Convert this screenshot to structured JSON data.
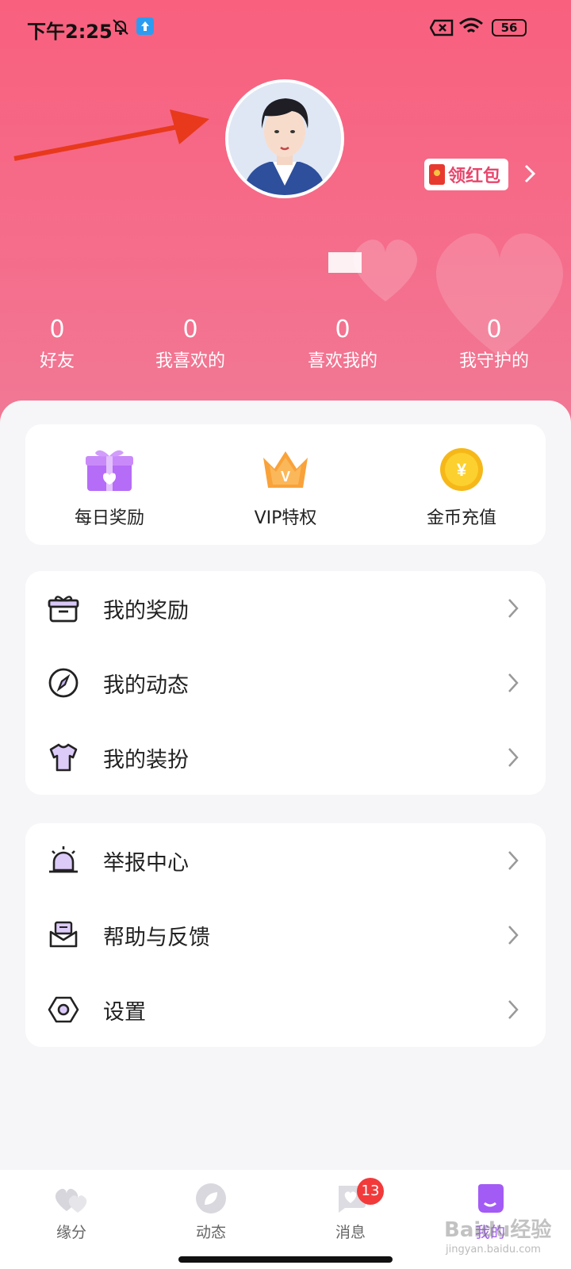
{
  "status_bar": {
    "time": "下午2:25",
    "battery": "56"
  },
  "header": {
    "red_packet_label": "领红包",
    "stats": [
      {
        "value": "0",
        "label": "好友"
      },
      {
        "value": "0",
        "label": "我喜欢的"
      },
      {
        "value": "0",
        "label": "喜欢我的"
      },
      {
        "value": "0",
        "label": "我守护的"
      }
    ]
  },
  "quick_actions": [
    {
      "label": "每日奖励",
      "icon": "gift-box-icon"
    },
    {
      "label": "VIP特权",
      "icon": "vip-crown-icon"
    },
    {
      "label": "金币充值",
      "icon": "gold-coin-icon"
    }
  ],
  "menu_group_1": [
    {
      "label": "我的奖励",
      "icon": "gift-icon"
    },
    {
      "label": "我的动态",
      "icon": "compass-icon"
    },
    {
      "label": "我的装扮",
      "icon": "tshirt-icon"
    }
  ],
  "menu_group_2": [
    {
      "label": "举报中心",
      "icon": "alarm-icon"
    },
    {
      "label": "帮助与反馈",
      "icon": "mail-icon"
    },
    {
      "label": "设置",
      "icon": "hex-settings-icon"
    }
  ],
  "tabbar": {
    "tabs": [
      {
        "label": "缘分"
      },
      {
        "label": "动态"
      },
      {
        "label": "消息",
        "badge": "13"
      },
      {
        "label": "我的"
      }
    ]
  },
  "watermark": {
    "text": "Baidu经验",
    "sub": "jingyan.baidu.com"
  },
  "colors": {
    "header_pink": "#f8607e",
    "accent_purple": "#a35bf5",
    "badge_red": "#f23a3a"
  }
}
